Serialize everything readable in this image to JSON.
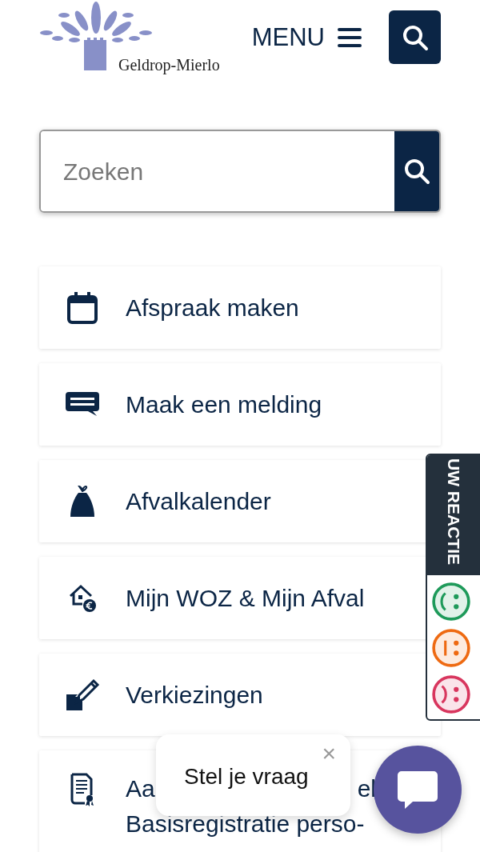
{
  "header": {
    "logo_text": "Geldrop-Mierlo",
    "menu_label": "MENU"
  },
  "search": {
    "placeholder": "Zoeken"
  },
  "tiles": [
    {
      "kind": "calendar",
      "label": "Afspraak maken"
    },
    {
      "kind": "chat",
      "label": "Maak een melding"
    },
    {
      "kind": "bag",
      "label": "Afvalkalender"
    },
    {
      "kind": "house",
      "label": "Mijn WOZ & Mijn Afval"
    },
    {
      "kind": "vote",
      "label": "Verkiezingen"
    },
    {
      "kind": "certificate",
      "label_parts": [
        "Aa",
        "el"
      ],
      "label_line_2": "Basisregistratie perso-"
    }
  ],
  "feedback": {
    "label": "UW REACTIE",
    "faces": [
      {
        "kind": "happy",
        "color": "#1e9a5a"
      },
      {
        "kind": "neutral",
        "color": "#ee6a12"
      },
      {
        "kind": "sad",
        "color": "#d8365e"
      }
    ]
  },
  "chat": {
    "prompt": "Stel je vraag",
    "close": "×"
  }
}
